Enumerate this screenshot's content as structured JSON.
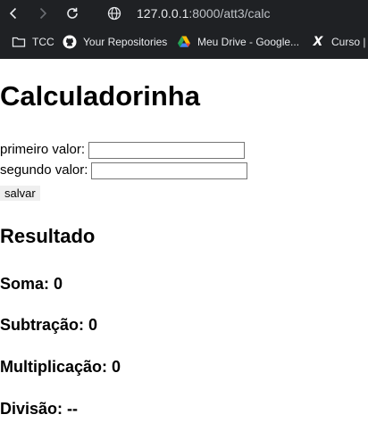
{
  "browser": {
    "url_host": "127.0.0.1",
    "url_path": ":8000/att3/calc",
    "bookmarks": [
      {
        "label": "TCC",
        "icon": "folder-icon"
      },
      {
        "label": "Your Repositories",
        "icon": "github-icon"
      },
      {
        "label": "Meu Drive - Google...",
        "icon": "google-drive-icon"
      },
      {
        "label": "Curso |",
        "icon": "x-logo-icon"
      }
    ]
  },
  "page": {
    "title": "Calculadorinha",
    "form": {
      "first_label": "primeiro valor:",
      "first_value": "",
      "second_label": "segundo valor:",
      "second_value": "",
      "save_label": "salvar"
    },
    "result_title": "Resultado",
    "results": [
      {
        "label": "Soma:",
        "value": "0"
      },
      {
        "label": "Subtração:",
        "value": "0"
      },
      {
        "label": "Multiplicação:",
        "value": "0"
      },
      {
        "label": "Divisão:",
        "value": "--"
      }
    ]
  }
}
